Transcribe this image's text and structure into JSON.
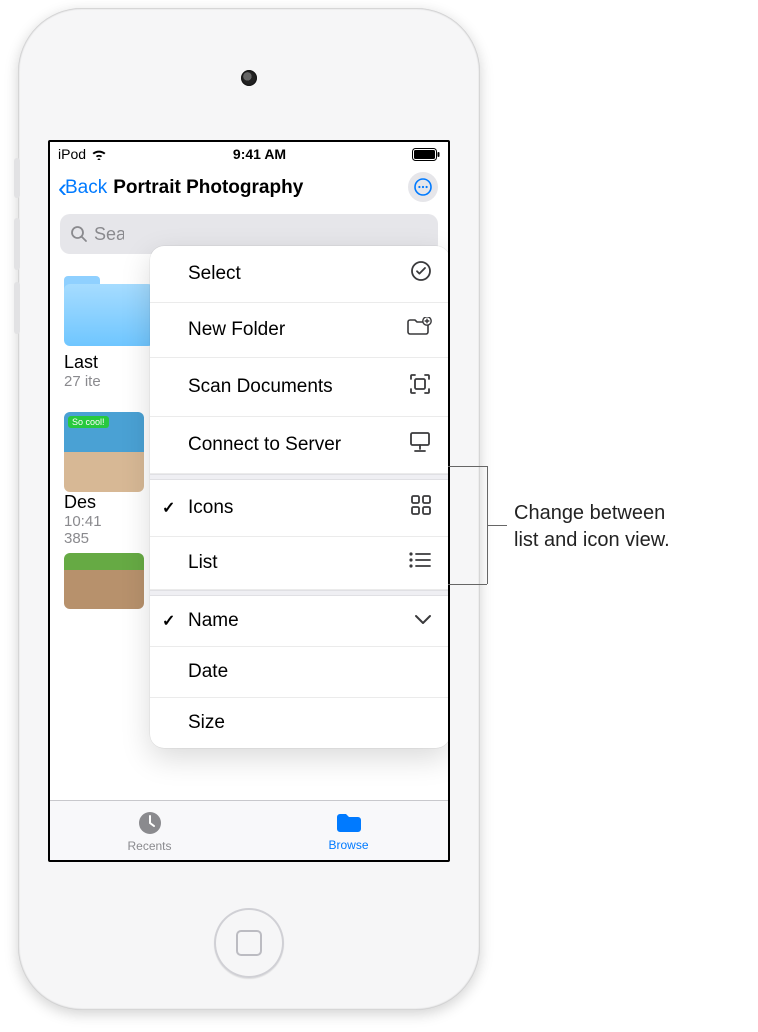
{
  "statusbar": {
    "carrier": "iPod",
    "time": "9:41 AM"
  },
  "nav": {
    "back": "Back",
    "title": "Portrait Photography"
  },
  "search": {
    "placeholder": "Search"
  },
  "folder": {
    "name": "Last",
    "sub_prefix": "27 ite"
  },
  "file": {
    "name": "Des",
    "time": "10:41",
    "size_prefix": "385"
  },
  "menu": {
    "select": "Select",
    "new_folder": "New Folder",
    "scan_documents": "Scan Documents",
    "connect_to_server": "Connect to Server",
    "icons": "Icons",
    "list": "List",
    "name": "Name",
    "date": "Date",
    "size": "Size"
  },
  "tabs": {
    "recents": "Recents",
    "browse": "Browse"
  },
  "callout": {
    "text_line1": "Change between",
    "text_line2": "list and icon view."
  }
}
